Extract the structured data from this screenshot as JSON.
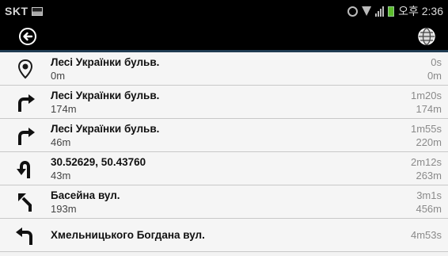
{
  "statusbar": {
    "carrier": "SKT",
    "clock": "오후 2:36"
  },
  "colors": {
    "accent_line": "#1f3b52",
    "battery": "#5cbc2b"
  },
  "toolbar": {
    "back_icon": "back-arrow-icon",
    "globe_icon": "globe-icon"
  },
  "directions": [
    {
      "icon": "location-pin-icon",
      "street": "Лесі Українки бульв.",
      "distance": "0m",
      "time": "0s",
      "total": "0m"
    },
    {
      "icon": "turn-right-icon",
      "street": "Лесі Українки бульв.",
      "distance": "174m",
      "time": "1m20s",
      "total": "174m"
    },
    {
      "icon": "turn-right-icon",
      "street": "Лесі Українки бульв.",
      "distance": "46m",
      "time": "1m55s",
      "total": "220m"
    },
    {
      "icon": "u-turn-left-icon",
      "street": "30.52629, 50.43760",
      "distance": "43m",
      "time": "2m12s",
      "total": "263m"
    },
    {
      "icon": "slight-left-icon",
      "street": "Басейна вул.",
      "distance": "193m",
      "time": "3m1s",
      "total": "456m"
    },
    {
      "icon": "turn-left-icon",
      "street": "Хмельницького Богдана вул.",
      "distance": "",
      "time": "4m53s",
      "total": ""
    }
  ]
}
